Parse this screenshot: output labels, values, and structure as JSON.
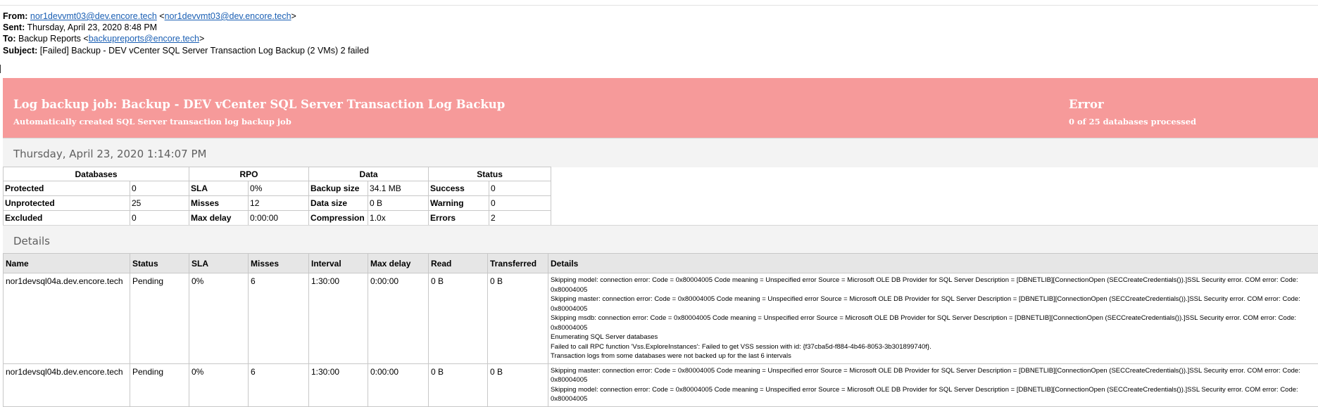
{
  "email": {
    "from_label": "From:",
    "from_addr": "nor1devvmt03@dev.encore.tech",
    "from_addr2": "nor1devvmt03@dev.encore.tech",
    "sent_label": "Sent:",
    "sent_value": "Thursday, April 23, 2020 8:48 PM",
    "to_label": "To:",
    "to_name": "Backup Reports <",
    "to_addr": "backupreports@encore.tech",
    "subject_label": "Subject:",
    "subject_value": "[Failed] Backup - DEV vCenter SQL Server Transaction Log Backup (2 VMs) 2 failed"
  },
  "banner": {
    "title": "Log backup job: Backup - DEV vCenter SQL Server Transaction Log Backup",
    "subtitle": "Automatically created SQL Server transaction log backup job",
    "status": "Error",
    "status_detail": "0 of 25 databases processed",
    "color": "#f69a9a"
  },
  "report_date": "Thursday, April 23, 2020 1:14:07 PM",
  "summary": {
    "headers": [
      "Databases",
      "RPO",
      "Data",
      "Status"
    ],
    "rows": [
      [
        "Protected",
        "0",
        "SLA",
        "0%",
        "Backup size",
        "34.1 MB",
        "Success",
        "0"
      ],
      [
        "Unprotected",
        "25",
        "Misses",
        "12",
        "Data size",
        "0 B",
        "Warning",
        "0"
      ],
      [
        "Excluded",
        "0",
        "Max delay",
        "0:00:00",
        "Compression",
        "1.0x",
        "Errors",
        "2"
      ]
    ]
  },
  "details_title": "Details",
  "details": {
    "headers": [
      "Name",
      "Status",
      "SLA",
      "Misses",
      "Interval",
      "Max delay",
      "Read",
      "Transferred",
      "Details"
    ],
    "rows": [
      {
        "cells": [
          "nor1devsql04a.dev.encore.tech",
          "Pending",
          "0%",
          "6",
          "1:30:00",
          "0:00:00",
          "0 B",
          "0 B"
        ],
        "messages": [
          "Skipping model: connection error: Code = 0x80004005 Code meaning = Unspecified error Source = Microsoft OLE DB Provider for SQL Server Description = [DBNETLIB][ConnectionOpen (SECCreateCredentials()).]SSL Security error. COM error: Code: 0x80004005",
          "Skipping master: connection error: Code = 0x80004005 Code meaning = Unspecified error Source = Microsoft OLE DB Provider for SQL Server Description = [DBNETLIB][ConnectionOpen (SECCreateCredentials()).]SSL Security error. COM error: Code: 0x80004005",
          "Skipping msdb: connection error: Code = 0x80004005 Code meaning = Unspecified error Source = Microsoft OLE DB Provider for SQL Server Description = [DBNETLIB][ConnectionOpen (SECCreateCredentials()).]SSL Security error. COM error: Code: 0x80004005",
          "Enumerating SQL Server databases",
          "Failed to call RPC function 'Vss.ExploreInstances': Failed to get VSS session with id: {f37cba5d-f884-4b46-8053-3b301899740f}.",
          "Transaction logs from some databases were not backed up for the last 6 intervals"
        ]
      },
      {
        "cells": [
          "nor1devsql04b.dev.encore.tech",
          "Pending",
          "0%",
          "6",
          "1:30:00",
          "0:00:00",
          "0 B",
          "0 B"
        ],
        "messages": [
          "Skipping master: connection error: Code = 0x80004005 Code meaning = Unspecified error Source = Microsoft OLE DB Provider for SQL Server Description = [DBNETLIB][ConnectionOpen (SECCreateCredentials()).]SSL Security error. COM error: Code: 0x80004005",
          "Skipping model: connection error: Code = 0x80004005 Code meaning = Unspecified error Source = Microsoft OLE DB Provider for SQL Server Description = [DBNETLIB][ConnectionOpen (SECCreateCredentials()).]SSL Security error. COM error: Code: 0x80004005"
        ]
      }
    ]
  }
}
